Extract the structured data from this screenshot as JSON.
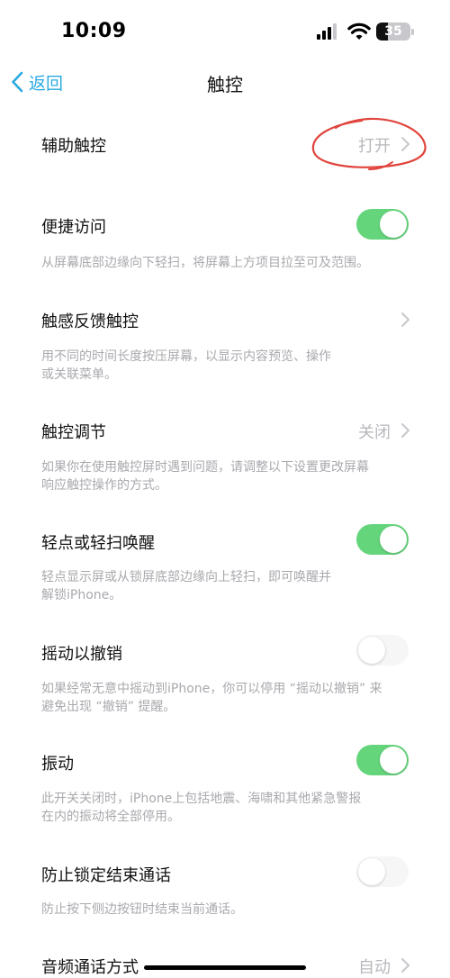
{
  "status_bar": {
    "time": "10:09",
    "battery_level": "35",
    "icons": [
      "signal-icon",
      "wifi-icon",
      "battery-icon"
    ]
  },
  "nav": {
    "back_label": "返回",
    "title": "触控",
    "accent_color": "#2aa9e0"
  },
  "settings": {
    "assistive_touch": {
      "label": "辅助触控",
      "value": "打开"
    },
    "reachability": {
      "label": "便捷访问",
      "on": true,
      "desc": "从屏幕底部边缘向下轻扫，将屏幕上方项目拉至可及范围。"
    },
    "haptic_touch": {
      "label": "触感反馈触控",
      "desc_line1": "用不同的时间长度按压屏幕，以显示内容预览、操作",
      "desc_line2": "或关联菜单。"
    },
    "touch_accommodations": {
      "label": "触控调节",
      "value": "关闭",
      "desc_line1": "如果你在使用触控屏时遇到问题，请调整以下设置更改屏幕",
      "desc_line2": "响应触控操作的方式。"
    },
    "tap_to_wake": {
      "label": "轻点或轻扫唤醒",
      "on": true,
      "desc_line1": "轻点显示屏或从锁屏底部边缘向上轻扫，即可唤醒并",
      "desc_line2": "解锁iPhone。"
    },
    "shake_to_undo": {
      "label": "摇动以撤销",
      "on": false,
      "desc_line1": "如果经常无意中摇动到iPhone，你可以停用 “摇动以撤销” 来",
      "desc_line2": "避免出现 “撤销” 提醒。"
    },
    "vibration": {
      "label": "振动",
      "on": true,
      "desc_line1": "此开关关闭时，iPhone上包括地震、海啸和其他紧急警报",
      "desc_line2": "在内的振动将全部停用。"
    },
    "prevent_lock_end_call": {
      "label": "防止锁定结束通话",
      "on": false,
      "desc": "防止按下侧边按钮时结束当前通话。"
    },
    "call_audio_routing": {
      "label": "音频通话方式",
      "value": "自动"
    }
  },
  "colors": {
    "toggle_on": "#65d57c",
    "toggle_off": "#f6f6f7",
    "annotation": "#e0443c"
  }
}
